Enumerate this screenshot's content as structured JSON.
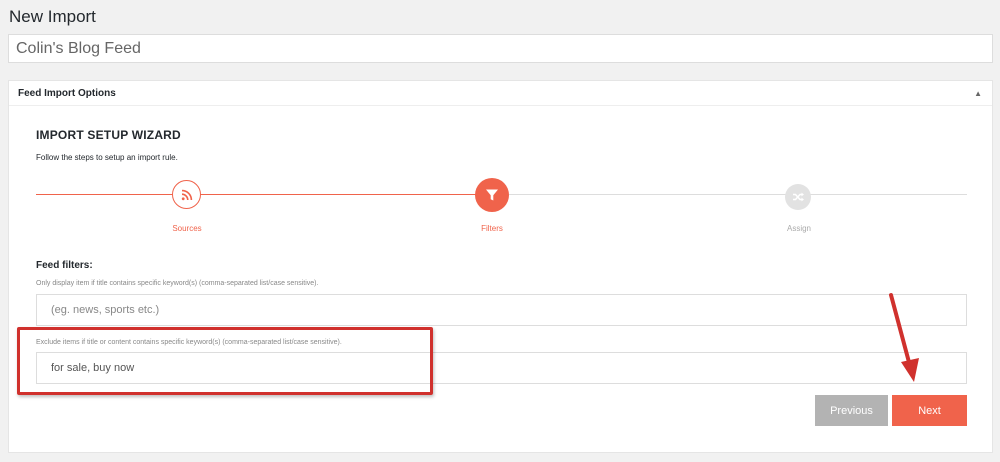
{
  "page": {
    "title": "New Import",
    "title_input_value": "Colin's Blog Feed"
  },
  "panel": {
    "header": "Feed Import Options",
    "toggle_icon": "triangle-up"
  },
  "wizard": {
    "title": "IMPORT SETUP WIZARD",
    "subtitle": "Follow the steps to setup an import rule.",
    "steps": [
      {
        "label": "Sources",
        "icon": "rss-icon",
        "state": "completed"
      },
      {
        "label": "Filters",
        "icon": "funnel-icon",
        "state": "active"
      },
      {
        "label": "Assign",
        "icon": "shuffle-icon",
        "state": "inactive"
      }
    ]
  },
  "filters": {
    "section_title": "Feed filters:",
    "include_help": "Only display item if title contains specific keyword(s) (comma-separated list/case sensitive).",
    "include_placeholder": "(eg. news, sports etc.)",
    "include_value": "",
    "exclude_help": "Exclude items if title or content contains specific keyword(s) (comma-separated list/case sensitive).",
    "exclude_value": "for sale, buy now"
  },
  "buttons": {
    "previous": "Previous",
    "next": "Next"
  },
  "colors": {
    "accent": "#f0634b",
    "annotation": "#d0312d",
    "disabled": "#b3b3b3"
  }
}
